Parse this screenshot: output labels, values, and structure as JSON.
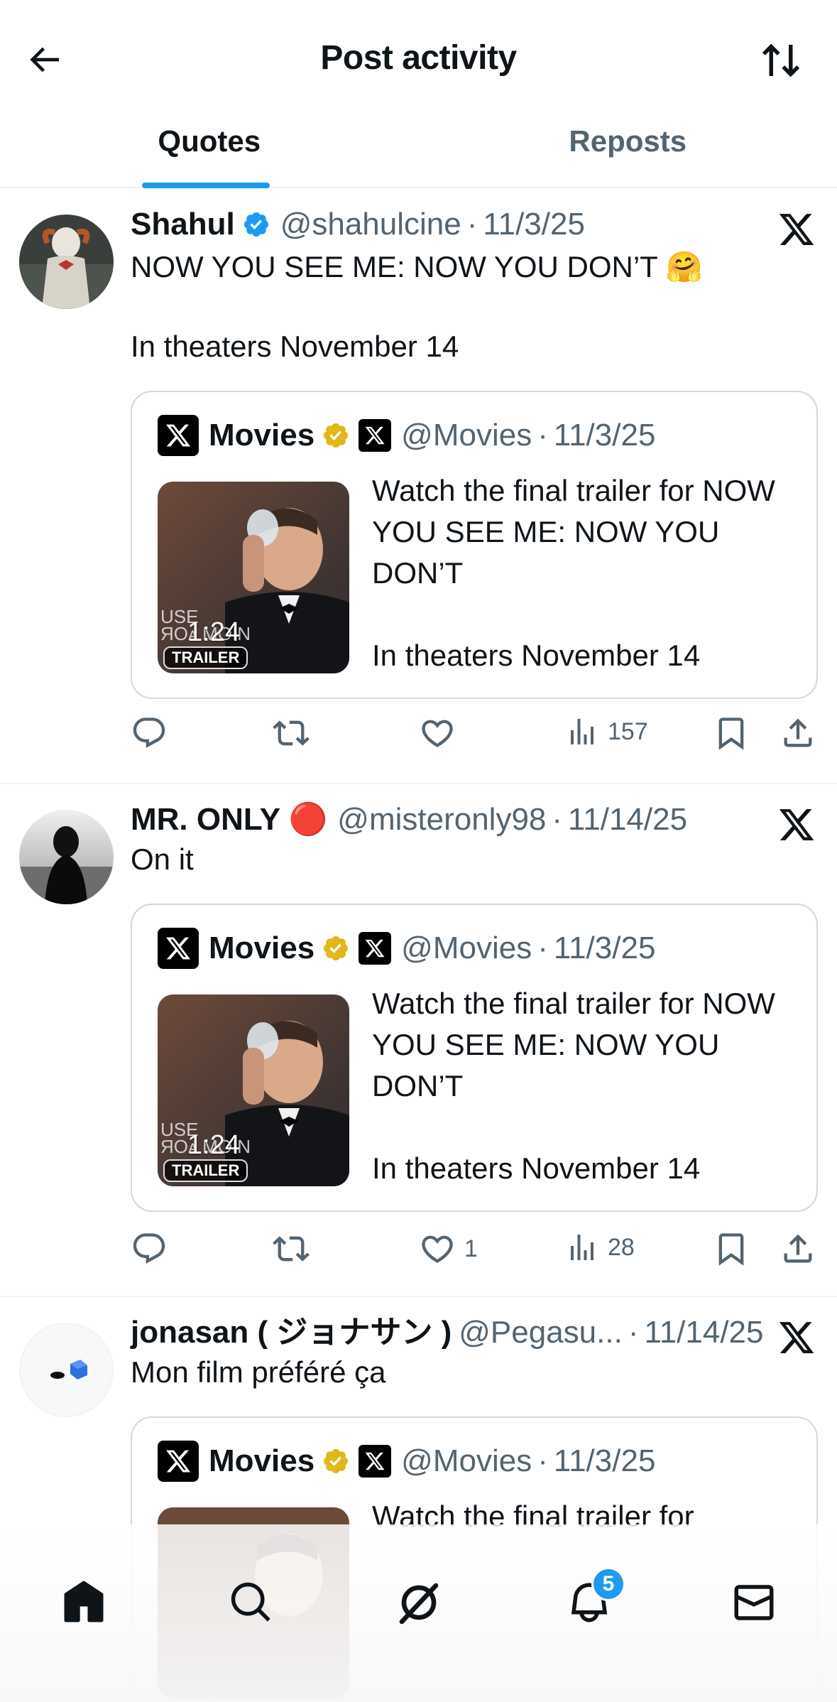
{
  "header": {
    "title": "Post activity",
    "back_icon": "arrow-left-icon",
    "sort_icon": "sort-arrows-icon"
  },
  "tabs": [
    {
      "label": "Quotes",
      "active": true
    },
    {
      "label": "Reposts",
      "active": false
    }
  ],
  "colors": {
    "accent": "#1d9bf0",
    "verified_blue": "#1d9bf0",
    "verified_gold": "#e2b719",
    "secondary_text": "#536471",
    "border": "#cfd9de"
  },
  "posts": [
    {
      "display_name": "Shahul",
      "verified": "blue",
      "handle": "@shahulcine",
      "separator": "·",
      "date": "11/3/25",
      "text": "NOW YOU SEE ME: NOW YOU DON’T 🤗\n\nIn theaters November 14",
      "quoted": {
        "display_name": "Movies",
        "handle": "@Movies",
        "separator": "·",
        "date": "11/3/25",
        "text": "Watch the final trailer for NOW YOU SEE ME: NOW YOU DON’T\n\nIn theaters November 14",
        "video_duration": "1:24",
        "thumb_badge": "TRAILER",
        "thumb_overlay": "USE\nЯОᴀ MOIN"
      },
      "actions": {
        "replies": "",
        "reposts": "",
        "likes": "",
        "views": "157"
      }
    },
    {
      "display_name": "MR. ONLY 🔴",
      "verified": "",
      "handle": "@misteronly98",
      "separator": "·",
      "date": "11/14/25",
      "text": "On it",
      "quoted": {
        "display_name": "Movies",
        "handle": "@Movies",
        "separator": "·",
        "date": "11/3/25",
        "text": "Watch the final trailer for NOW YOU SEE ME: NOW YOU DON’T\n\nIn theaters November 14",
        "video_duration": "1:24",
        "thumb_badge": "TRAILER",
        "thumb_overlay": "USE\nЯОᴀ MOIN"
      },
      "actions": {
        "replies": "",
        "reposts": "",
        "likes": "1",
        "views": "28"
      }
    },
    {
      "display_name": "jonasan ( ジョナサン )",
      "verified": "",
      "handle": "@Pegasu...",
      "separator": "·",
      "date": "11/14/25",
      "text": "Mon film préféré ça",
      "quoted": {
        "display_name": "Movies",
        "handle": "@Movies",
        "separator": "·",
        "date": "11/3/25",
        "text": "Watch the final trailer for"
      }
    }
  ],
  "bottom_nav": {
    "items": [
      "home-icon",
      "search-icon",
      "grok-icon",
      "notifications-icon",
      "messages-icon"
    ],
    "notification_count": "5"
  }
}
